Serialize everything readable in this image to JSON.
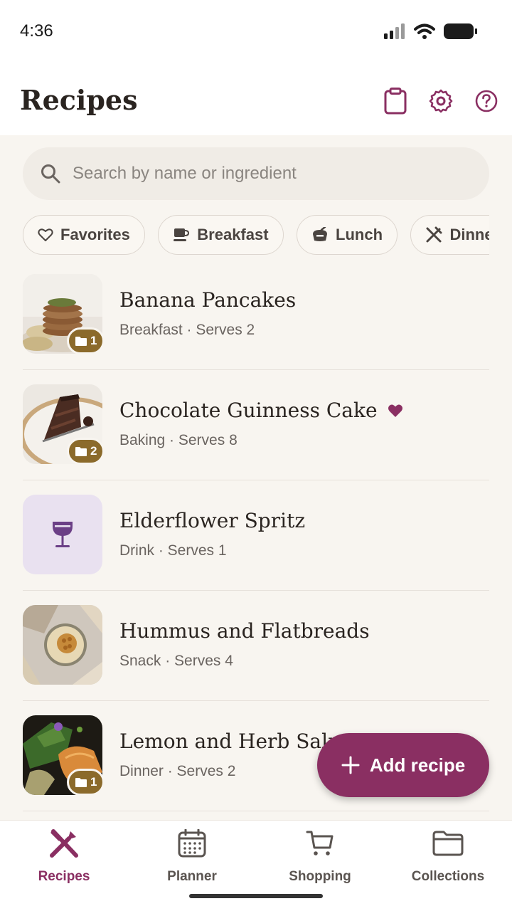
{
  "status_bar": {
    "time": "4:36"
  },
  "header": {
    "title": "Recipes"
  },
  "header_actions": [
    {
      "icon": "clipboard-icon"
    },
    {
      "icon": "gear-icon"
    },
    {
      "icon": "help-icon"
    }
  ],
  "search": {
    "placeholder": "Search by name or ingredient",
    "value": ""
  },
  "chips": [
    {
      "label": "Favorites",
      "icon": "heart-outline-icon"
    },
    {
      "label": "Breakfast",
      "icon": "coffee-cup-icon"
    },
    {
      "label": "Lunch",
      "icon": "takeaway-icon"
    },
    {
      "label": "Dinner",
      "icon": "utensils-icon"
    }
  ],
  "recipes": [
    {
      "title": "Banana Pancakes",
      "meta": "Breakfast · Serves 2",
      "collections": "1",
      "favorite": false,
      "thumb": "photo"
    },
    {
      "title": "Chocolate Guinness Cake",
      "meta": "Baking · Serves 8",
      "collections": "2",
      "favorite": true,
      "thumb": "photo"
    },
    {
      "title": "Elderflower Spritz",
      "meta": "Drink · Serves 1",
      "collections": null,
      "favorite": false,
      "thumb": "wine-glass-icon"
    },
    {
      "title": "Hummus and Flatbreads",
      "meta": "Snack · Serves 4",
      "collections": null,
      "favorite": false,
      "thumb": "photo"
    },
    {
      "title": "Lemon and Herb Salmon",
      "meta": "Dinner · Serves 2",
      "collections": "1",
      "favorite": false,
      "thumb": "photo"
    }
  ],
  "fab": {
    "label": "Add recipe",
    "icon": "plus-icon"
  },
  "bottom_nav": [
    {
      "label": "Recipes",
      "icon": "utensils-icon",
      "active": true
    },
    {
      "label": "Planner",
      "icon": "calendar-icon",
      "active": false
    },
    {
      "label": "Shopping",
      "icon": "cart-icon",
      "active": false
    },
    {
      "label": "Collections",
      "icon": "folder-icon",
      "active": false
    }
  ],
  "colors": {
    "accent": "#8a2f62",
    "badge": "#8b6a2b",
    "background": "#f8f5f0",
    "drink_thumb_bg": "#e9e1f0"
  }
}
